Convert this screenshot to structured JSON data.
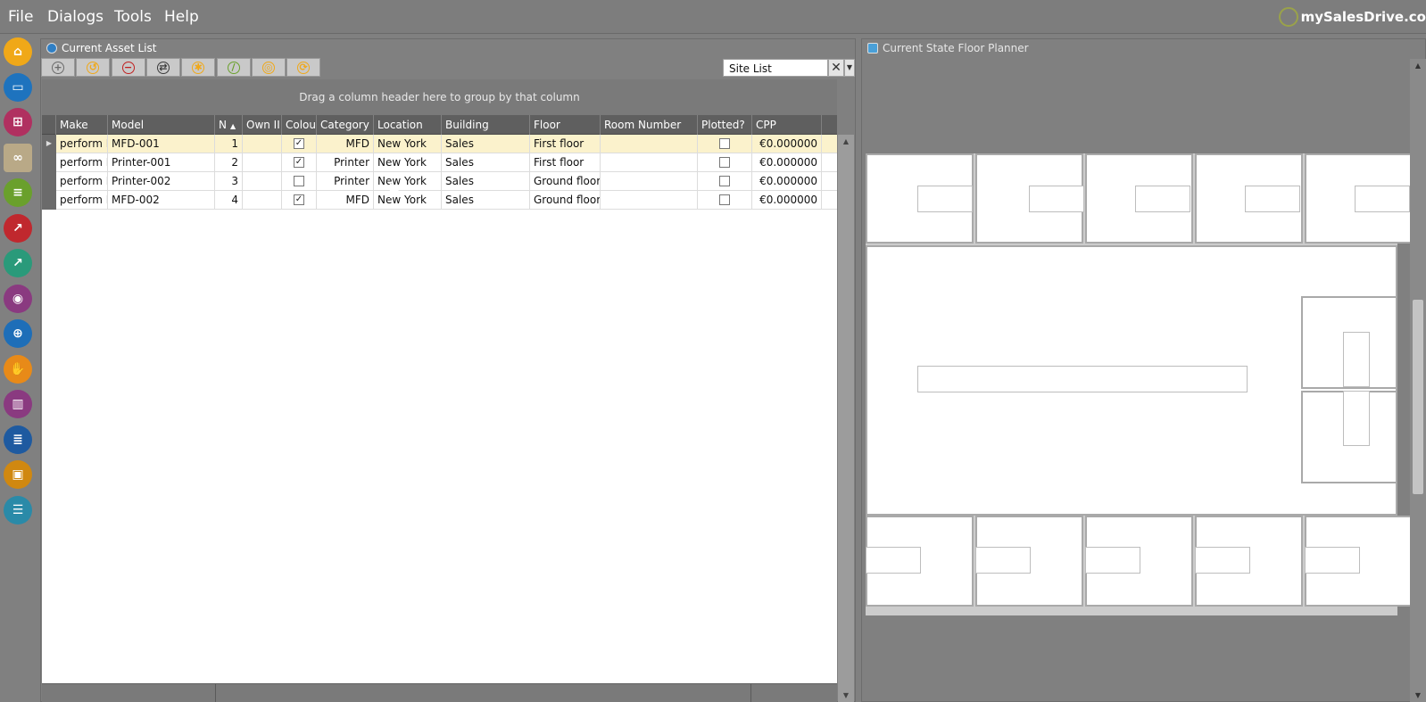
{
  "menu": {
    "file": "File",
    "dialogs": "Dialogs",
    "tools": "Tools",
    "help": "Help"
  },
  "brand": {
    "text": "mySalesDrive.co",
    "logo_icon": "target-logo-icon"
  },
  "nav_icons": [
    {
      "name": "home-icon",
      "color": "#f0a818"
    },
    {
      "name": "folder-icon",
      "color": "#1e73be"
    },
    {
      "name": "org-chart-icon",
      "color": "#b03060"
    },
    {
      "name": "binoculars-icon",
      "color": "#a8b0b8"
    },
    {
      "name": "scroll-icon",
      "color": "#6aa02c"
    },
    {
      "name": "area-chart-icon",
      "color": "#c0282e"
    },
    {
      "name": "trend-chart-icon",
      "color": "#2a9a7a"
    },
    {
      "name": "eye-icon",
      "color": "#8a3a80"
    },
    {
      "name": "target-icon",
      "color": "#1e6eb8"
    },
    {
      "name": "handshake-icon",
      "color": "#e88a18"
    },
    {
      "name": "building-icon",
      "color": "#8a3a80"
    },
    {
      "name": "document-icon",
      "color": "#1e5aa0"
    },
    {
      "name": "briefcase-icon",
      "color": "#d08810"
    },
    {
      "name": "database-icon",
      "color": "#2a8aa8"
    }
  ],
  "asset_panel": {
    "title": "Current Asset List",
    "site_list": "Site List",
    "clear_symbol": "✕",
    "dropdown_symbol": "▼",
    "toolbar_icons": [
      {
        "name": "add-icon",
        "glyph": "+",
        "color": "#6a6a6a"
      },
      {
        "name": "undo-icon",
        "glyph": "↺",
        "color": "#f0a818"
      },
      {
        "name": "remove-icon",
        "glyph": "−",
        "color": "#c02020"
      },
      {
        "name": "move-icon",
        "glyph": "⇄",
        "color": "#3a3a3a"
      },
      {
        "name": "star-icon",
        "glyph": "✱",
        "color": "#f0a818"
      },
      {
        "name": "ruler-icon",
        "glyph": "/",
        "color": "#6aa02c"
      },
      {
        "name": "locate-icon",
        "glyph": "◎",
        "color": "#f0a818"
      },
      {
        "name": "refresh-icon",
        "glyph": "⟳",
        "color": "#f0a818"
      }
    ],
    "group_hint": "Drag a column header here to group by that column",
    "columns": [
      "Make",
      "Model",
      "N",
      "Own II",
      "Colou",
      "Category",
      "Location",
      "Building",
      "Floor",
      "Room Number",
      "Plotted?",
      "CPP"
    ],
    "sort_indicator": "▲",
    "row_indicator": "▶",
    "rows": [
      {
        "make": "perform I",
        "model": "MFD-001",
        "n": "1",
        "own": "",
        "colour": true,
        "category": "MFD",
        "location": "New York",
        "building": "Sales",
        "floor": "First floor",
        "room": "",
        "plotted": false,
        "cpp": "€0.000000"
      },
      {
        "make": "perform I",
        "model": "Printer-001",
        "n": "2",
        "own": "",
        "colour": true,
        "category": "Printer",
        "location": "New York",
        "building": "Sales",
        "floor": "First floor",
        "room": "",
        "plotted": false,
        "cpp": "€0.000000"
      },
      {
        "make": "perform I",
        "model": "Printer-002",
        "n": "3",
        "own": "",
        "colour": false,
        "category": "Printer",
        "location": "New York",
        "building": "Sales",
        "floor": "Ground floor",
        "room": "",
        "plotted": false,
        "cpp": "€0.000000"
      },
      {
        "make": "perform I",
        "model": "MFD-002",
        "n": "4",
        "own": "",
        "colour": true,
        "category": "MFD",
        "location": "New York",
        "building": "Sales",
        "floor": "Ground floor",
        "room": "",
        "plotted": false,
        "cpp": "€0.000000"
      }
    ],
    "check_mark": "✓",
    "scroll_up": "▲",
    "scroll_down": "▼"
  },
  "floor_panel": {
    "title": "Current State Floor Planner",
    "scroll_up": "▲",
    "scroll_down": "▼"
  }
}
